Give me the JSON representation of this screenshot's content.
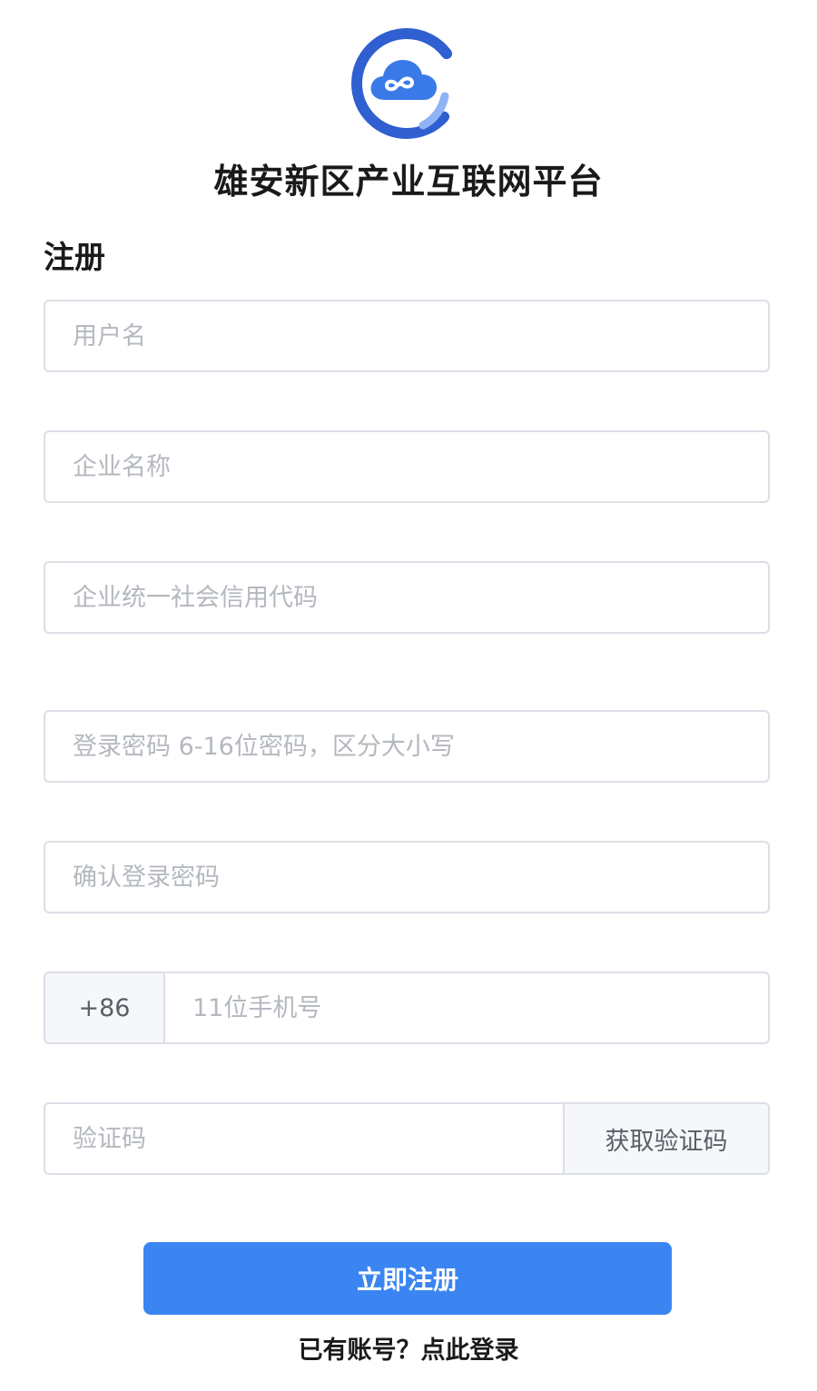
{
  "brand": {
    "logo_icon": "cloud-infinity-logo-icon",
    "title": "雄安新区产业互联网平台",
    "colors": {
      "primary": "#3a85f1",
      "logo_ring": "#2f5fd0",
      "logo_accent": "#8fb4f5"
    }
  },
  "form": {
    "title": "注册",
    "fields": {
      "username": {
        "placeholder": "用户名",
        "value": ""
      },
      "company_name": {
        "placeholder": "企业名称",
        "value": ""
      },
      "credit_code": {
        "placeholder": "企业统一社会信用代码",
        "value": ""
      },
      "password": {
        "placeholder": "登录密码 6-16位密码，区分大小写",
        "value": ""
      },
      "confirm_password": {
        "placeholder": "确认登录密码",
        "value": ""
      },
      "phone": {
        "prefix": "+86",
        "placeholder": "11位手机号",
        "value": ""
      },
      "code": {
        "placeholder": "验证码",
        "value": "",
        "button_label": "获取验证码"
      }
    },
    "submit_label": "立即注册",
    "login_link": "已有账号？点此登录"
  }
}
